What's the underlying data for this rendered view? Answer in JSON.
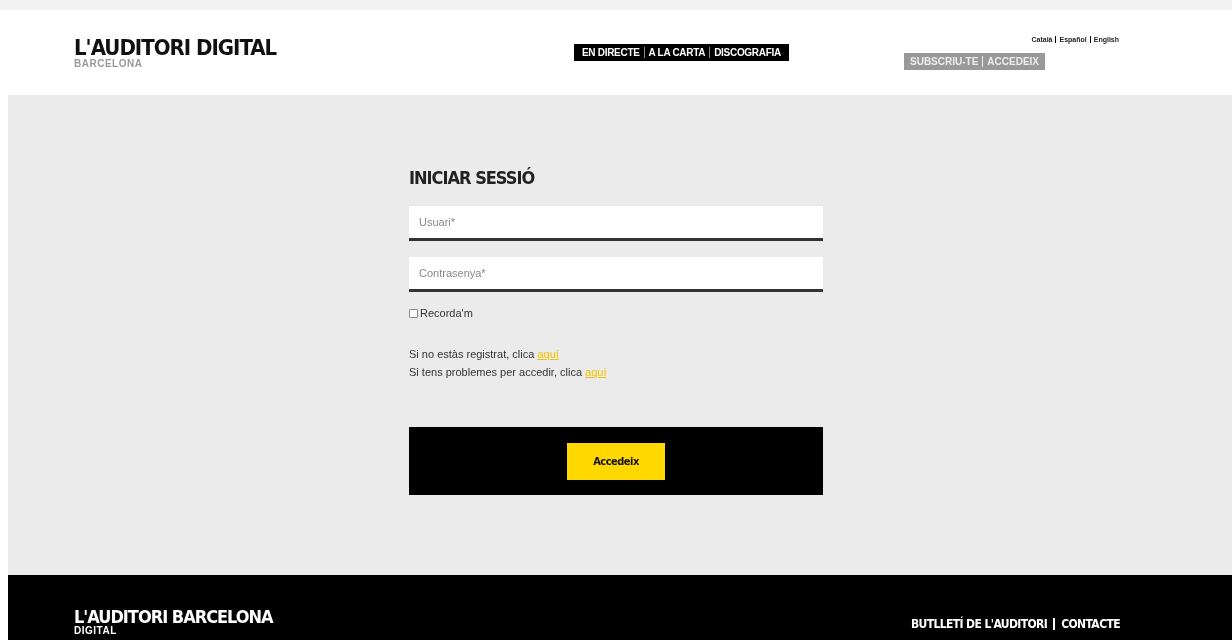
{
  "header": {
    "logo": {
      "title": "L'AUDITORI DIGITAL",
      "subtitle": "BARCELONA"
    },
    "nav": [
      {
        "label": "EN DIRECTE"
      },
      {
        "label": "A LA CARTA"
      },
      {
        "label": "DISCOGRAFIA"
      }
    ],
    "languages": [
      {
        "label": "Català"
      },
      {
        "label": "Español"
      },
      {
        "label": "English"
      }
    ],
    "account": [
      {
        "label": "SUBSCRIU-TE"
      },
      {
        "label": "ACCEDEIX"
      }
    ]
  },
  "login": {
    "title": "INICIAR SESSIÓ",
    "fields": [
      {
        "placeholder": "Usuari*"
      },
      {
        "placeholder": "Contrasenya*"
      }
    ],
    "remember": {
      "label": "Recorda'm",
      "checked": false
    },
    "help": [
      {
        "text": "Si no estàs registrat, clica ",
        "link": "aquí"
      },
      {
        "text": "Si tens problemes per accedir, clica ",
        "link": "aquí"
      }
    ],
    "submit": "Accedeix"
  },
  "footer": {
    "logo": {
      "title": "L'AUDITORI BARCELONA",
      "subtitle": "DIGITAL"
    },
    "links": [
      {
        "label": "BUTLLETÍ DE L'AUDITORI"
      },
      {
        "label": "CONTACTE"
      }
    ]
  }
}
